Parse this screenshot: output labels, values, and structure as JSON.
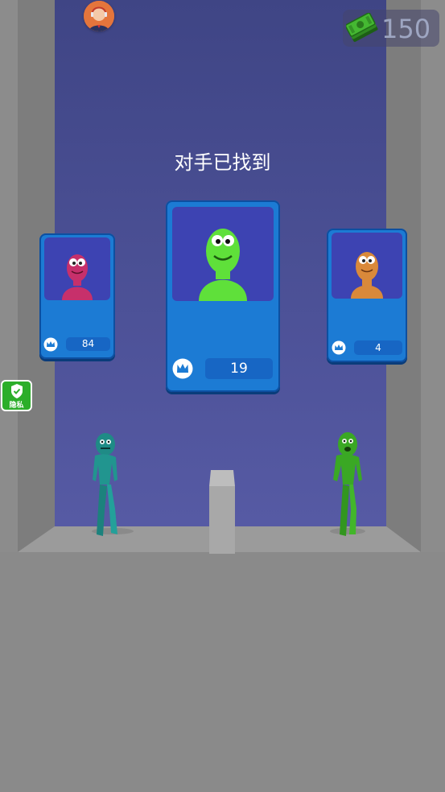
{
  "hud": {
    "avatar_icon": "player-avatar",
    "cash_icon": "cash-stack-icon",
    "cash_value": "150"
  },
  "title": "对手已找到",
  "cards": [
    {
      "id": "left",
      "character": "pink-monster",
      "score": "84",
      "crown_icon": "crown-icon"
    },
    {
      "id": "center",
      "character": "green-monster",
      "score": "19",
      "crown_icon": "crown-icon"
    },
    {
      "id": "right",
      "character": "orange-monster",
      "score": "4",
      "crown_icon": "crown-icon"
    }
  ],
  "privacy": {
    "label": "隐私",
    "icon": "shield-check-icon"
  },
  "colors": {
    "back_wall": "#4a4f93",
    "side_wall": "#7a7a7a",
    "floor": "#8a8a8a",
    "card": "#1c7bd4",
    "teal_fighter": "#21958f",
    "green_fighter": "#3aa824"
  }
}
